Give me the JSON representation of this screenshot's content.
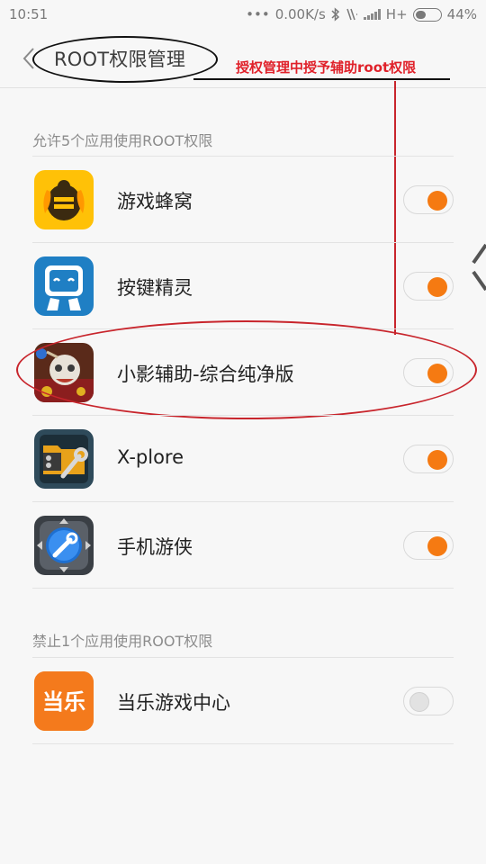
{
  "status_bar": {
    "time": "10:51",
    "dots": "•••",
    "network_speed": "0.00K/s",
    "bluetooth_icon": "bluetooth-icon",
    "vibrate_icon": "vibrate-icon",
    "network_type": "H+",
    "battery_level": 0.44,
    "battery_text": "44%"
  },
  "header": {
    "back_icon": "chevron-left-icon",
    "title": "ROOT权限管理"
  },
  "annotation": {
    "text": "授权管理中授予辅助root权限",
    "color": "#e0212a"
  },
  "allowed_section": {
    "title": "允许5个应用使用ROOT权限",
    "apps": [
      {
        "name": "游戏蜂窝",
        "icon": "bee-icon",
        "enabled": true
      },
      {
        "name": "按键精灵",
        "icon": "robot-icon",
        "enabled": true
      },
      {
        "name": "小影辅助-综合纯净版",
        "icon": "warrior-icon",
        "enabled": true
      },
      {
        "name": "X-plore",
        "icon": "folder-wrench-icon",
        "enabled": true
      },
      {
        "name": "手机游侠",
        "icon": "wrench-icon",
        "enabled": true
      }
    ]
  },
  "blocked_section": {
    "title": "禁止1个应用使用ROOT权限",
    "apps": [
      {
        "name": "当乐游戏中心",
        "icon": "dangle-icon",
        "icon_text": "当乐",
        "enabled": false
      }
    ]
  },
  "colors": {
    "toggle_on": "#f57a12",
    "toggle_off": "#e2e2e2",
    "background": "#f7f7f7"
  }
}
